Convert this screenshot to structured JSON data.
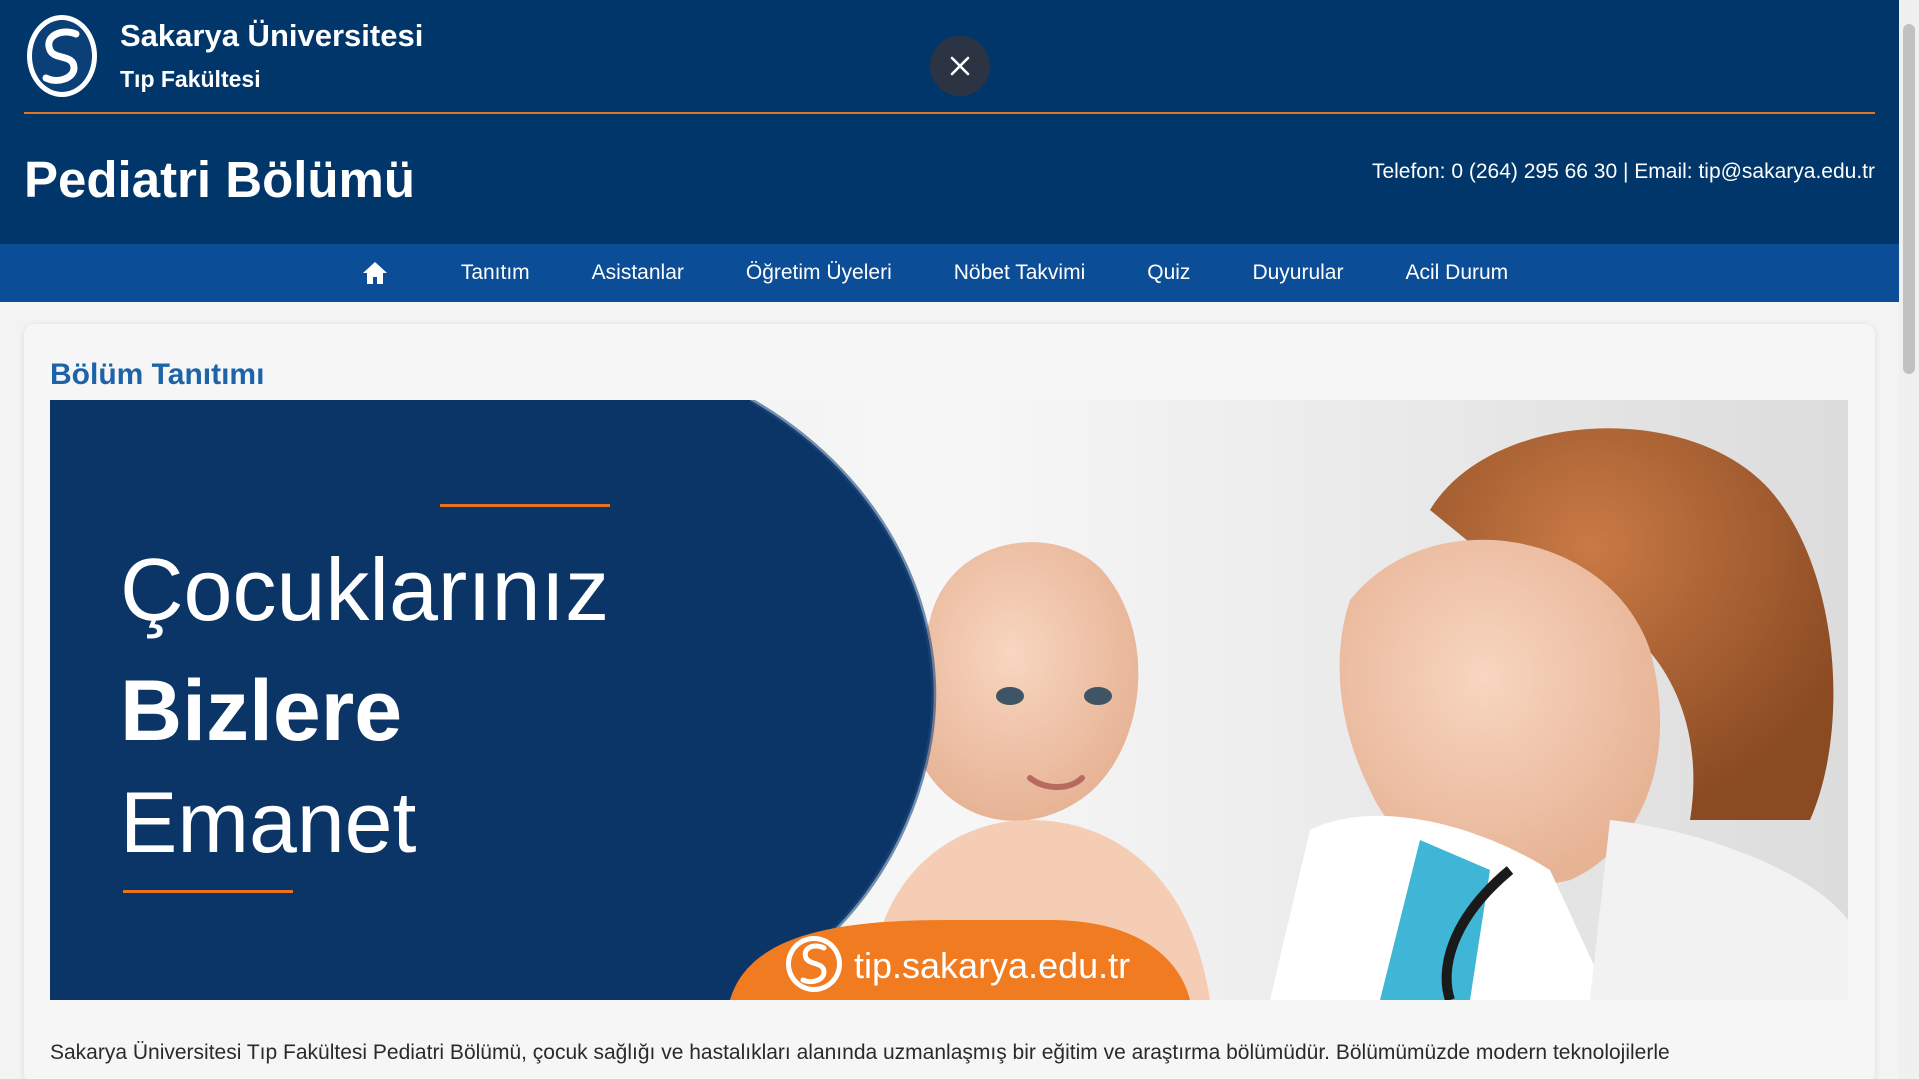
{
  "header": {
    "university": "Sakarya Üniversitesi",
    "faculty": "Tıp Fakültesi",
    "department": "Pediatri Bölümü",
    "contact": "Telefon: 0 (264) 295 66 30 | Email: tip@sakarya.edu.tr"
  },
  "nav": {
    "home_icon": "home-icon",
    "items": [
      "Tanıtım",
      "Asistanlar",
      "Öğretim Üyeleri",
      "Nöbet Takvimi",
      "Quiz",
      "Duyurular",
      "Acil Durum"
    ]
  },
  "section": {
    "title": "Bölüm Tanıtımı"
  },
  "banner": {
    "line1": "Çocuklarınız",
    "line2": "Bizlere",
    "line3": "Emanet",
    "url": "tip.sakarya.edu.tr"
  },
  "body": {
    "text": "Sakarya Üniversitesi Tıp Fakültesi Pediatri Bölümü, çocuk sağlığı ve hastalıkları alanında uzmanlaşmış bir eğitim ve araştırma bölümüdür. Bölümümüzde modern teknolojilerle"
  },
  "colors": {
    "header_bg": "#003669",
    "nav_bg": "#0c4d97",
    "accent_orange": "#e8731e",
    "section_title": "#1d63a8"
  }
}
